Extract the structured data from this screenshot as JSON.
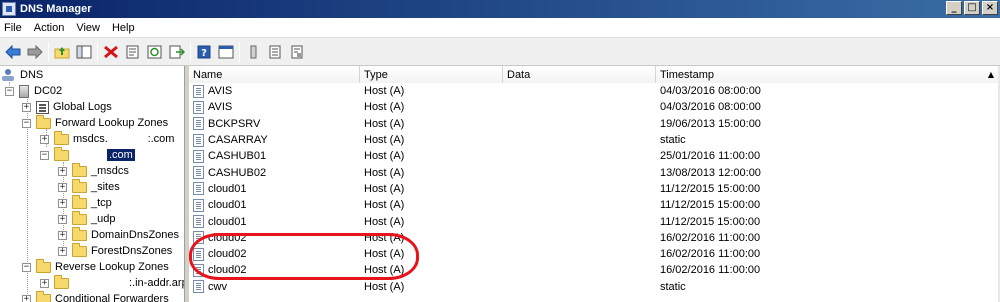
{
  "window": {
    "title": "DNS Manager",
    "min_glyph": "_",
    "max_glyph": "□",
    "close_glyph": "×"
  },
  "menu": [
    "File",
    "Action",
    "View",
    "Help"
  ],
  "toolbar_icons": [
    "back-arrow-icon",
    "forward-arrow-icon",
    "up-folder-icon",
    "show-hide-tree-icon",
    "delete-icon",
    "properties-icon",
    "refresh-icon",
    "export-list-icon",
    "help-icon",
    "view-icon",
    "new-host-icon",
    "list-view-icon",
    "details-view-icon"
  ],
  "tree": {
    "root": "DNS",
    "server": "DC02",
    "global_logs": "Global Logs",
    "forward_zones": "Forward Lookup Zones",
    "msdcs_zone": "msdcs.             :.com",
    "selected_zone": ".com",
    "children": [
      "_msdcs",
      "_sites",
      "_tcp",
      "_udp",
      "DomainDnsZones",
      "ForestDnsZones"
    ],
    "reverse_zones": "Reverse Lookup Zones",
    "reverse_zone_child": ":.in-addr.arpa",
    "conditional": "Conditional Forwarders"
  },
  "list": {
    "columns": [
      "Name",
      "Type",
      "Data",
      "Timestamp"
    ],
    "sort_glyph": "▲",
    "rows": [
      {
        "name": "AVIS",
        "type": "Host (A)",
        "data": "",
        "timestamp": "04/03/2016 08:00:00"
      },
      {
        "name": "AVIS",
        "type": "Host (A)",
        "data": "",
        "timestamp": "04/03/2016 08:00:00"
      },
      {
        "name": "BCKPSRV",
        "type": "Host (A)",
        "data": "",
        "timestamp": "19/06/2013 15:00:00"
      },
      {
        "name": "CASARRAY",
        "type": "Host (A)",
        "data": "",
        "timestamp": "static"
      },
      {
        "name": "CASHUB01",
        "type": "Host (A)",
        "data": "",
        "timestamp": "25/01/2016 11:00:00"
      },
      {
        "name": "CASHUB02",
        "type": "Host (A)",
        "data": "",
        "timestamp": "13/08/2013 12:00:00"
      },
      {
        "name": "cloud01",
        "type": "Host (A)",
        "data": "",
        "timestamp": "11/12/2015 15:00:00"
      },
      {
        "name": "cloud01",
        "type": "Host (A)",
        "data": "",
        "timestamp": "11/12/2015 15:00:00"
      },
      {
        "name": "cloud01",
        "type": "Host (A)",
        "data": "",
        "timestamp": "11/12/2015 15:00:00"
      },
      {
        "name": "cloud02",
        "type": "Host (A)",
        "data": "",
        "timestamp": "16/02/2016 11:00:00"
      },
      {
        "name": "cloud02",
        "type": "Host (A)",
        "data": "",
        "timestamp": "16/02/2016 11:00:00"
      },
      {
        "name": "cloud02",
        "type": "Host (A)",
        "data": "",
        "timestamp": "16/02/2016 11:00:00"
      },
      {
        "name": "cwv",
        "type": "Host (A)",
        "data": "",
        "timestamp": "static"
      }
    ]
  },
  "colors": {
    "highlight": "#e8141b",
    "selection": "#0a246a"
  }
}
